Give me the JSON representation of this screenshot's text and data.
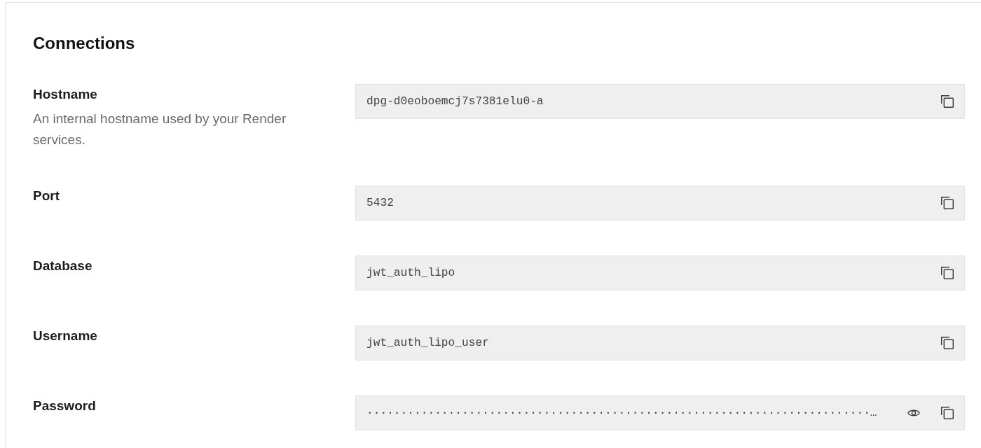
{
  "section": {
    "title": "Connections"
  },
  "fields": [
    {
      "kind": "text",
      "label": "Hostname",
      "description": "An internal hostname used by your Render services.",
      "value": "dpg-d0eoboemcj7s7381elu0-a"
    },
    {
      "kind": "text",
      "label": "Port",
      "value": "5432"
    },
    {
      "kind": "text",
      "label": "Database",
      "value": "jwt_auth_lipo"
    },
    {
      "kind": "text",
      "label": "Username",
      "value": "jwt_auth_lipo_user"
    },
    {
      "kind": "secret",
      "label": "Password",
      "value": "··········································································…"
    }
  ]
}
